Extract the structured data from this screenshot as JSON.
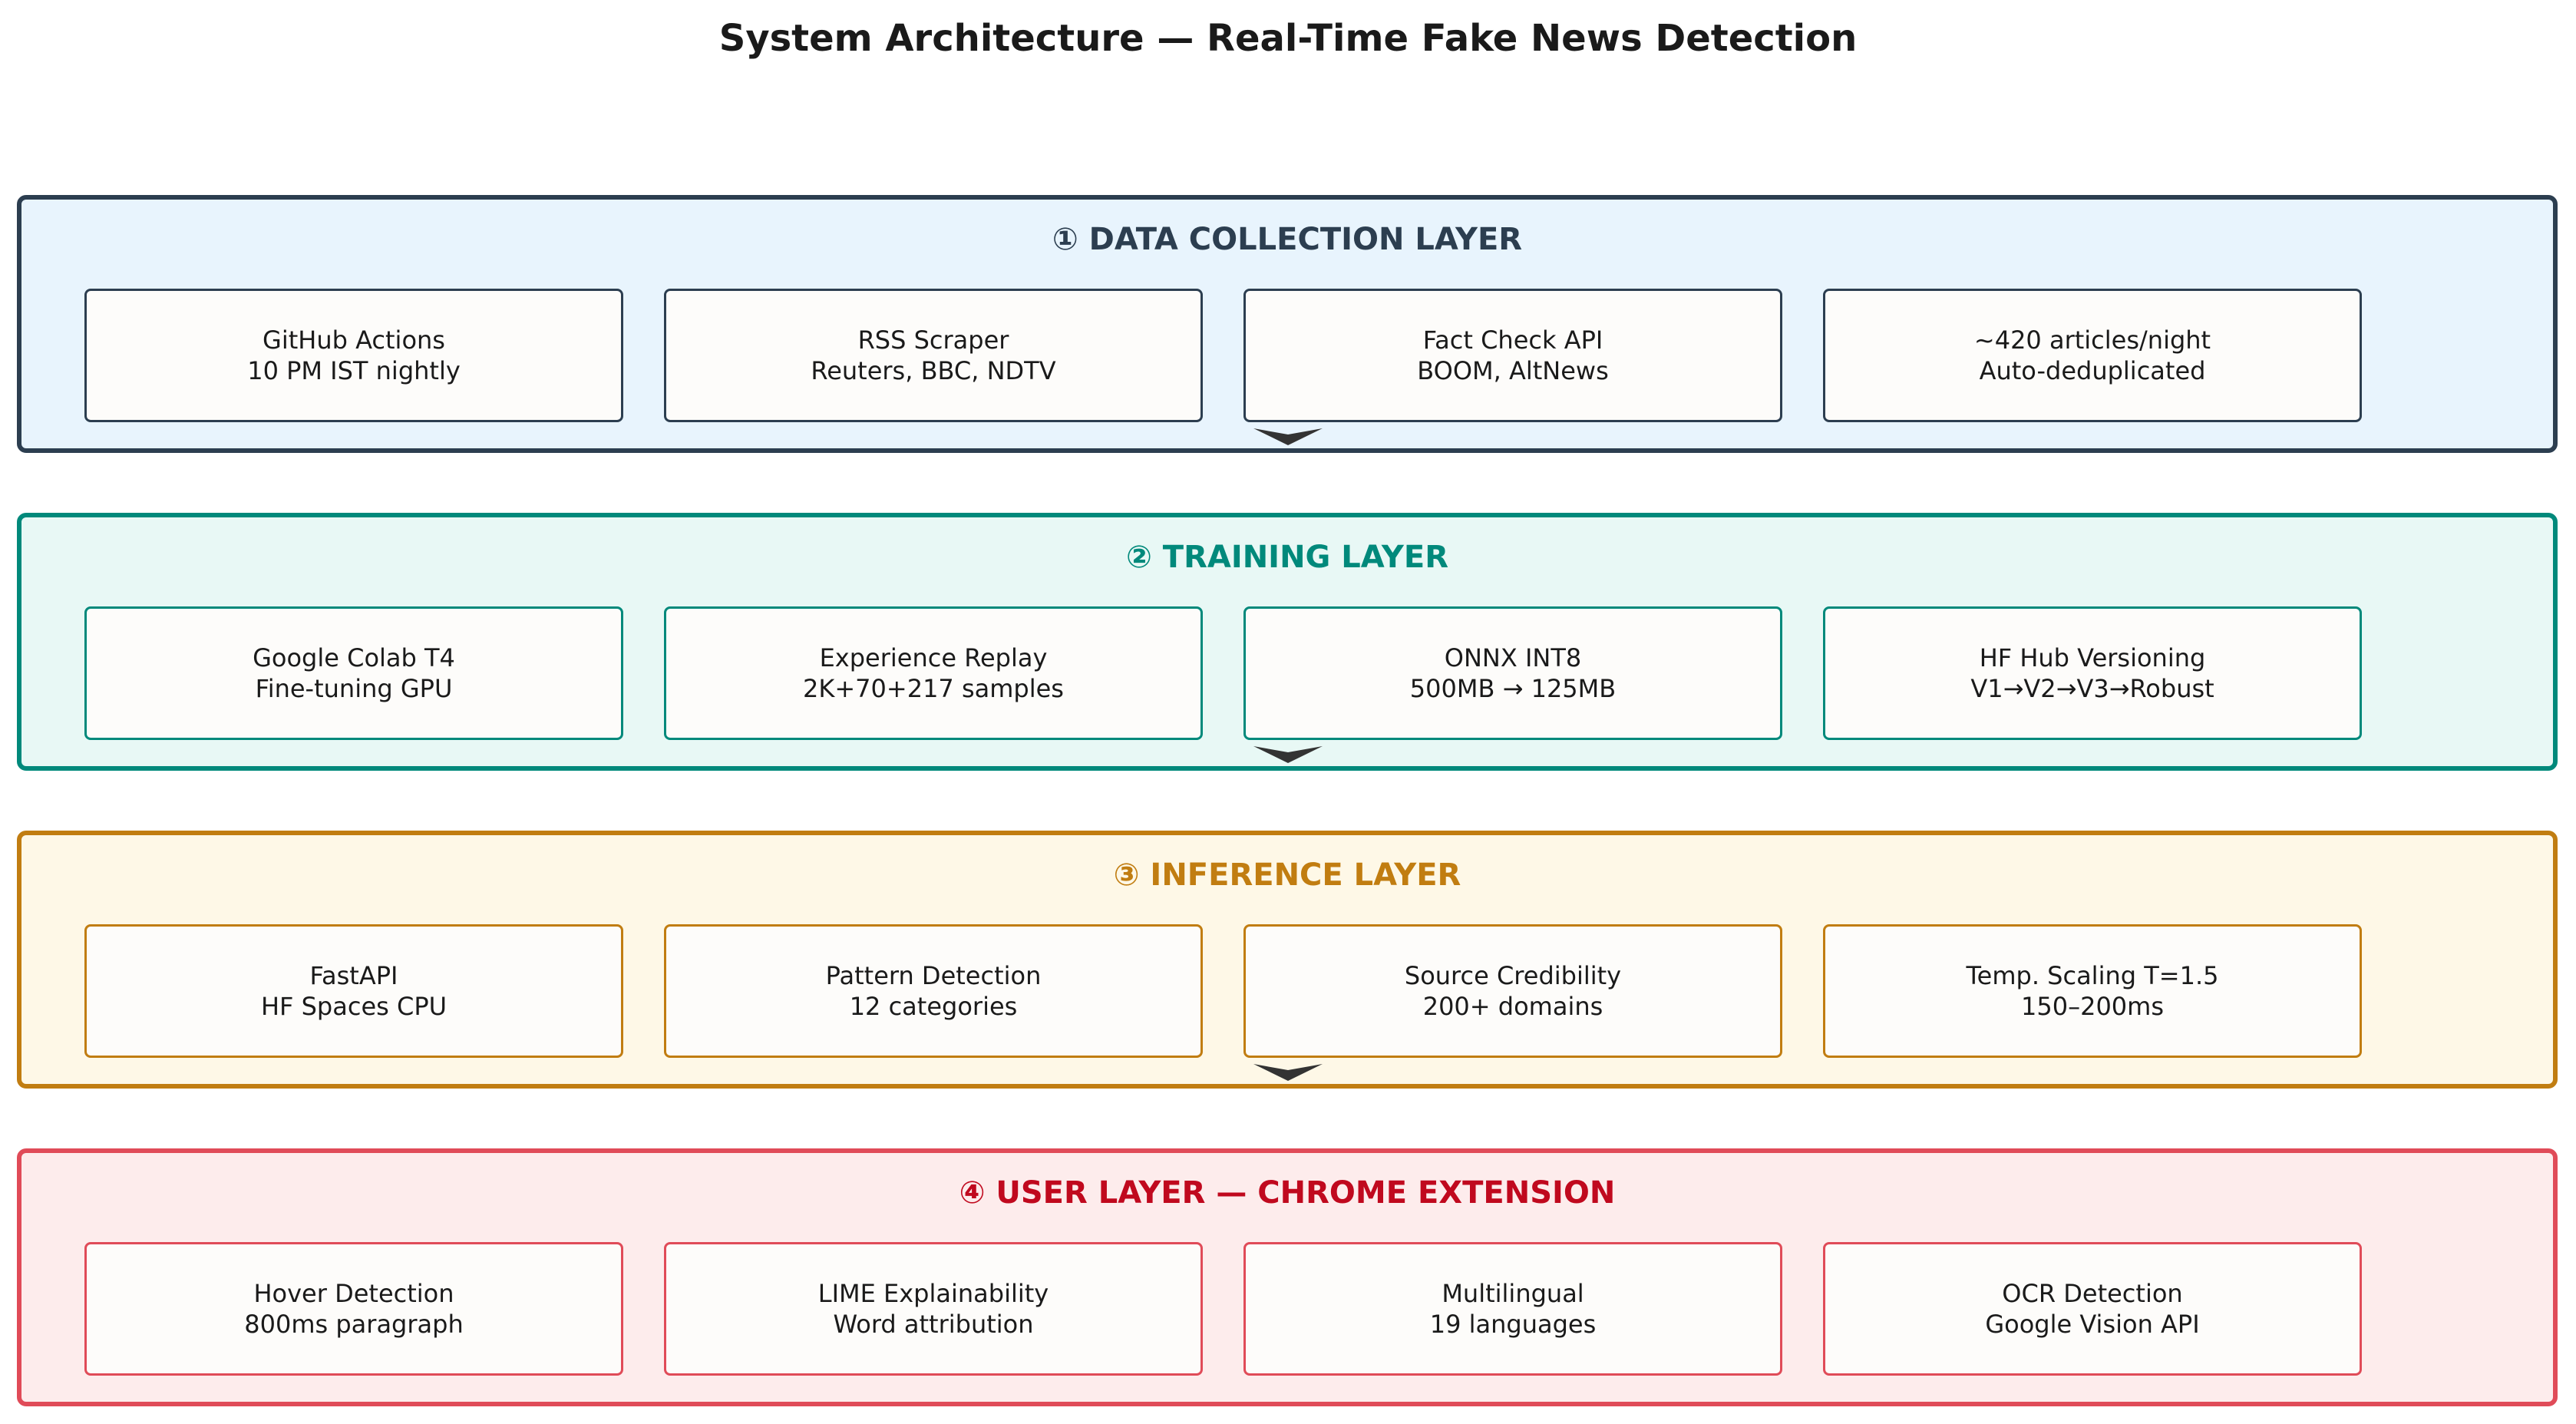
{
  "title": "System Architecture — Real-Time Fake News Detection",
  "layers": [
    {
      "title": "① DATA COLLECTION LAYER",
      "border_color": "#2c3e50",
      "bg_color": "#e8f4fd",
      "title_color": "#2c3e50",
      "cards": [
        {
          "line1": "GitHub Actions",
          "line2": "10 PM IST nightly"
        },
        {
          "line1": "RSS Scraper",
          "line2": "Reuters, BBC, NDTV"
        },
        {
          "line1": "Fact Check API",
          "line2": "BOOM, AltNews"
        },
        {
          "line1": "~420 articles/night",
          "line2": "Auto-deduplicated"
        }
      ]
    },
    {
      "title": "② TRAINING LAYER",
      "border_color": "#00897b",
      "bg_color": "#e8f8f5",
      "title_color": "#00897b",
      "cards": [
        {
          "line1": "Google Colab T4",
          "line2": "Fine-tuning GPU"
        },
        {
          "line1": "Experience Replay",
          "line2": "2K+70+217 samples"
        },
        {
          "line1": "ONNX INT8",
          "line2": "500MB → 125MB"
        },
        {
          "line1": "HF Hub Versioning",
          "line2": "V1→V2→V3→Robust"
        }
      ]
    },
    {
      "title": "③ INFERENCE LAYER",
      "border_color": "#c17d11",
      "bg_color": "#fef8e7",
      "title_color": "#c17d11",
      "cards": [
        {
          "line1": "FastAPI",
          "line2": "HF Spaces CPU"
        },
        {
          "line1": "Pattern Detection",
          "line2": "12 categories"
        },
        {
          "line1": "Source Credibility",
          "line2": "200+ domains"
        },
        {
          "line1": "Temp. Scaling T=1.5",
          "line2": "150–200ms"
        }
      ]
    },
    {
      "title": "④ USER LAYER — CHROME EXTENSION",
      "border_color": "#e04b58",
      "bg_color": "#fdecec",
      "title_color": "#c0091e",
      "cards": [
        {
          "line1": "Hover Detection",
          "line2": "800ms paragraph"
        },
        {
          "line1": "LIME Explainability",
          "line2": "Word attribution"
        },
        {
          "line1": "Multilingual",
          "line2": "19 languages"
        },
        {
          "line1": "OCR Detection",
          "line2": "Google Vision API"
        }
      ]
    }
  ],
  "connectors": [
    {
      "name": "connector-data-to-training",
      "icon": "down-arrow-icon",
      "color": "#333333"
    },
    {
      "name": "connector-training-to-inference",
      "icon": "down-arrow-icon",
      "color": "#333333"
    },
    {
      "name": "connector-inference-to-user",
      "icon": "down-arrow-icon",
      "color": "#333333"
    }
  ]
}
